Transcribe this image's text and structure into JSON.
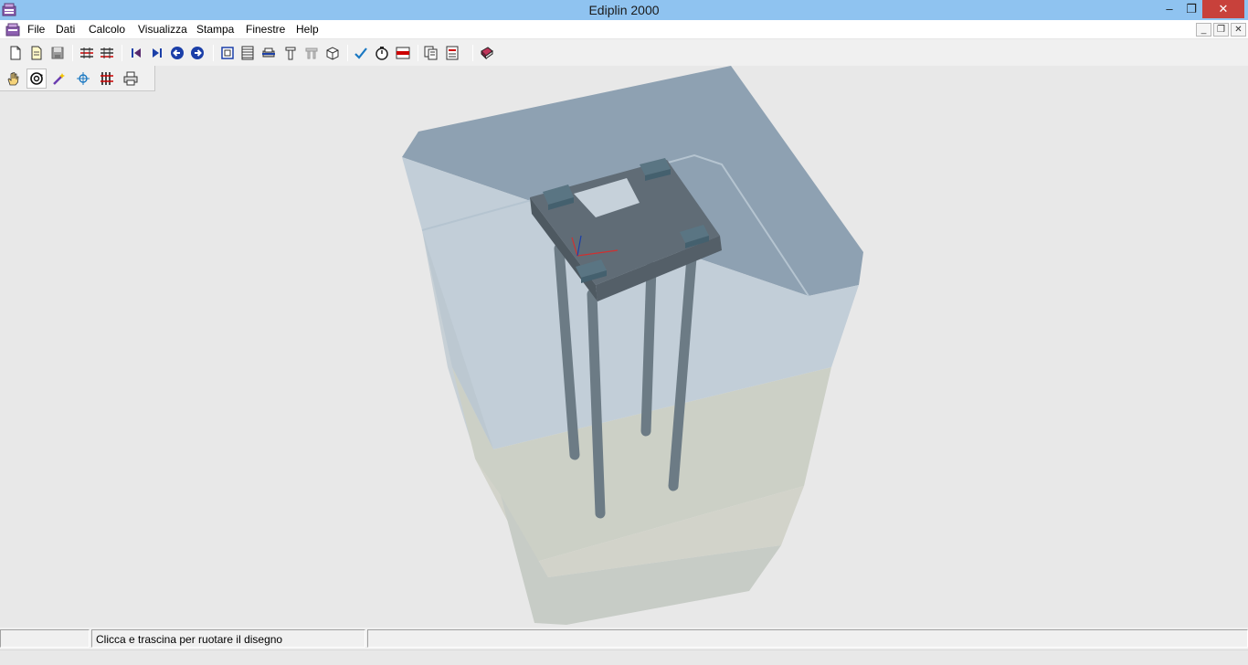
{
  "window": {
    "title": "Ediplin 2000",
    "minimize_glyph": "–",
    "maximize_glyph": "❐",
    "close_glyph": "✕"
  },
  "menu": {
    "items": [
      "File",
      "Dati",
      "Calcolo",
      "Visualizza",
      "Stampa",
      "Finestre",
      "Help"
    ],
    "mdi_minimize": "_",
    "mdi_restore": "❐",
    "mdi_close": "✕"
  },
  "toolbar_main": {
    "icons": [
      "new-file-icon",
      "open-file-icon",
      "save-icon",
      "grid-data-icon",
      "grid-data-alt-icon",
      "first-record-icon",
      "last-record-icon",
      "back-arrow-icon",
      "forward-arrow-icon",
      "zoom-extents-icon",
      "table-icon",
      "print-preview-icon",
      "pile-section-icon",
      "disabled-icon",
      "3d-view-icon",
      "check-icon",
      "timer-icon",
      "results-icon",
      "copy-pages-icon",
      "report-icon",
      "book-icon"
    ]
  },
  "toolbar_view": {
    "icons": [
      "pan-hand-icon",
      "rotate-icon",
      "magic-wand-icon",
      "crosshair-icon",
      "piles-grid-icon",
      "printer-icon"
    ],
    "active": "rotate-icon"
  },
  "statusbar": {
    "pane1": "",
    "pane2": "Clicca e trascina per ruotare il disegno",
    "pane3": ""
  },
  "colors": {
    "titlebar": "#8fc3f0",
    "close_button": "#c8413b",
    "viewport_bg": "#e8e8e8",
    "cap_color": "#5a6670",
    "pile_color": "#6b7a84",
    "soil_top": "#8fa2b3",
    "soil_upper": "#c4d1db",
    "soil_lower": "#cfd2c8"
  }
}
